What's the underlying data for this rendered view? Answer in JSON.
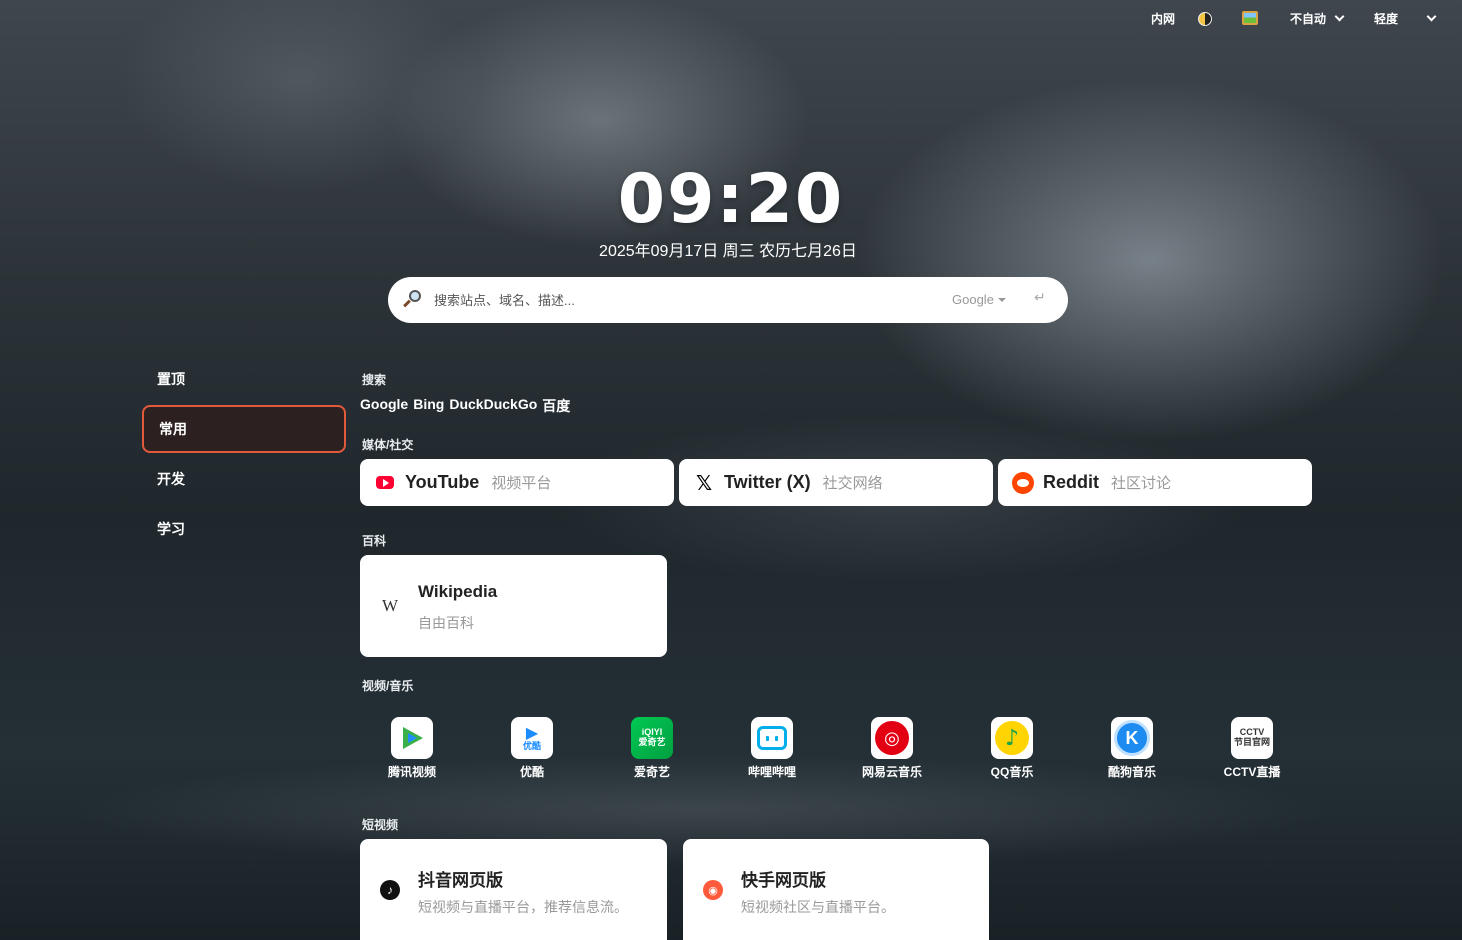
{
  "topbar": {
    "network_label": "内网",
    "theme_icon": "half-moon-icon",
    "wallpaper_icon": "picture-icon",
    "auto_label": "不自动",
    "level_label": "轻度"
  },
  "clock": {
    "time": "09:20",
    "date": "2025年09月17日 周三 农历七月26日"
  },
  "search": {
    "placeholder": "搜索站点、域名、描述...",
    "engine": "Google",
    "enter_symbol": "↵"
  },
  "sidebar": {
    "items": [
      {
        "label": "置顶",
        "active": false
      },
      {
        "label": "常用",
        "active": true
      },
      {
        "label": "开发",
        "active": false
      },
      {
        "label": "学习",
        "active": false
      }
    ]
  },
  "sections": {
    "search": {
      "title": "搜索",
      "links": [
        "Google",
        "Bing",
        "DuckDuckGo",
        "百度"
      ]
    },
    "social": {
      "title": "媒体/社交",
      "cards": [
        {
          "name": "YouTube",
          "desc": "视频平台",
          "icon": "youtube-icon"
        },
        {
          "name": "Twitter (X)",
          "desc": "社交网络",
          "icon": "x-icon"
        },
        {
          "name": "Reddit",
          "desc": "社区讨论",
          "icon": "reddit-icon"
        }
      ]
    },
    "wiki": {
      "title": "百科",
      "cards": [
        {
          "name": "Wikipedia",
          "desc": "自由百科",
          "icon_glyph": "W"
        }
      ]
    },
    "media": {
      "title": "视频/音乐",
      "apps": [
        {
          "label": "腾讯视频",
          "icon": "tencent-video-icon"
        },
        {
          "label": "优酷",
          "icon": "youku-icon",
          "icon_text": "优酷"
        },
        {
          "label": "爱奇艺",
          "icon": "iqiyi-icon",
          "icon_text_top": "iQIYI",
          "icon_text_bottom": "爱奇艺"
        },
        {
          "label": "哔哩哔哩",
          "icon": "bilibili-icon"
        },
        {
          "label": "网易云音乐",
          "icon": "netease-music-icon"
        },
        {
          "label": "QQ音乐",
          "icon": "qq-music-icon"
        },
        {
          "label": "酷狗音乐",
          "icon": "kugou-icon",
          "icon_text": "K"
        },
        {
          "label": "CCTV直播",
          "icon": "cctv-icon",
          "icon_text_top": "CCTV",
          "icon_text_bottom": "节目官网"
        }
      ]
    },
    "short_video": {
      "title": "短视频",
      "cards": [
        {
          "name": "抖音网页版",
          "desc": "短视频与直播平台，推荐信息流。",
          "icon": "douyin-icon"
        },
        {
          "name": "快手网页版",
          "desc": "短视频社区与直播平台。",
          "icon": "kuaishou-icon"
        }
      ]
    }
  }
}
